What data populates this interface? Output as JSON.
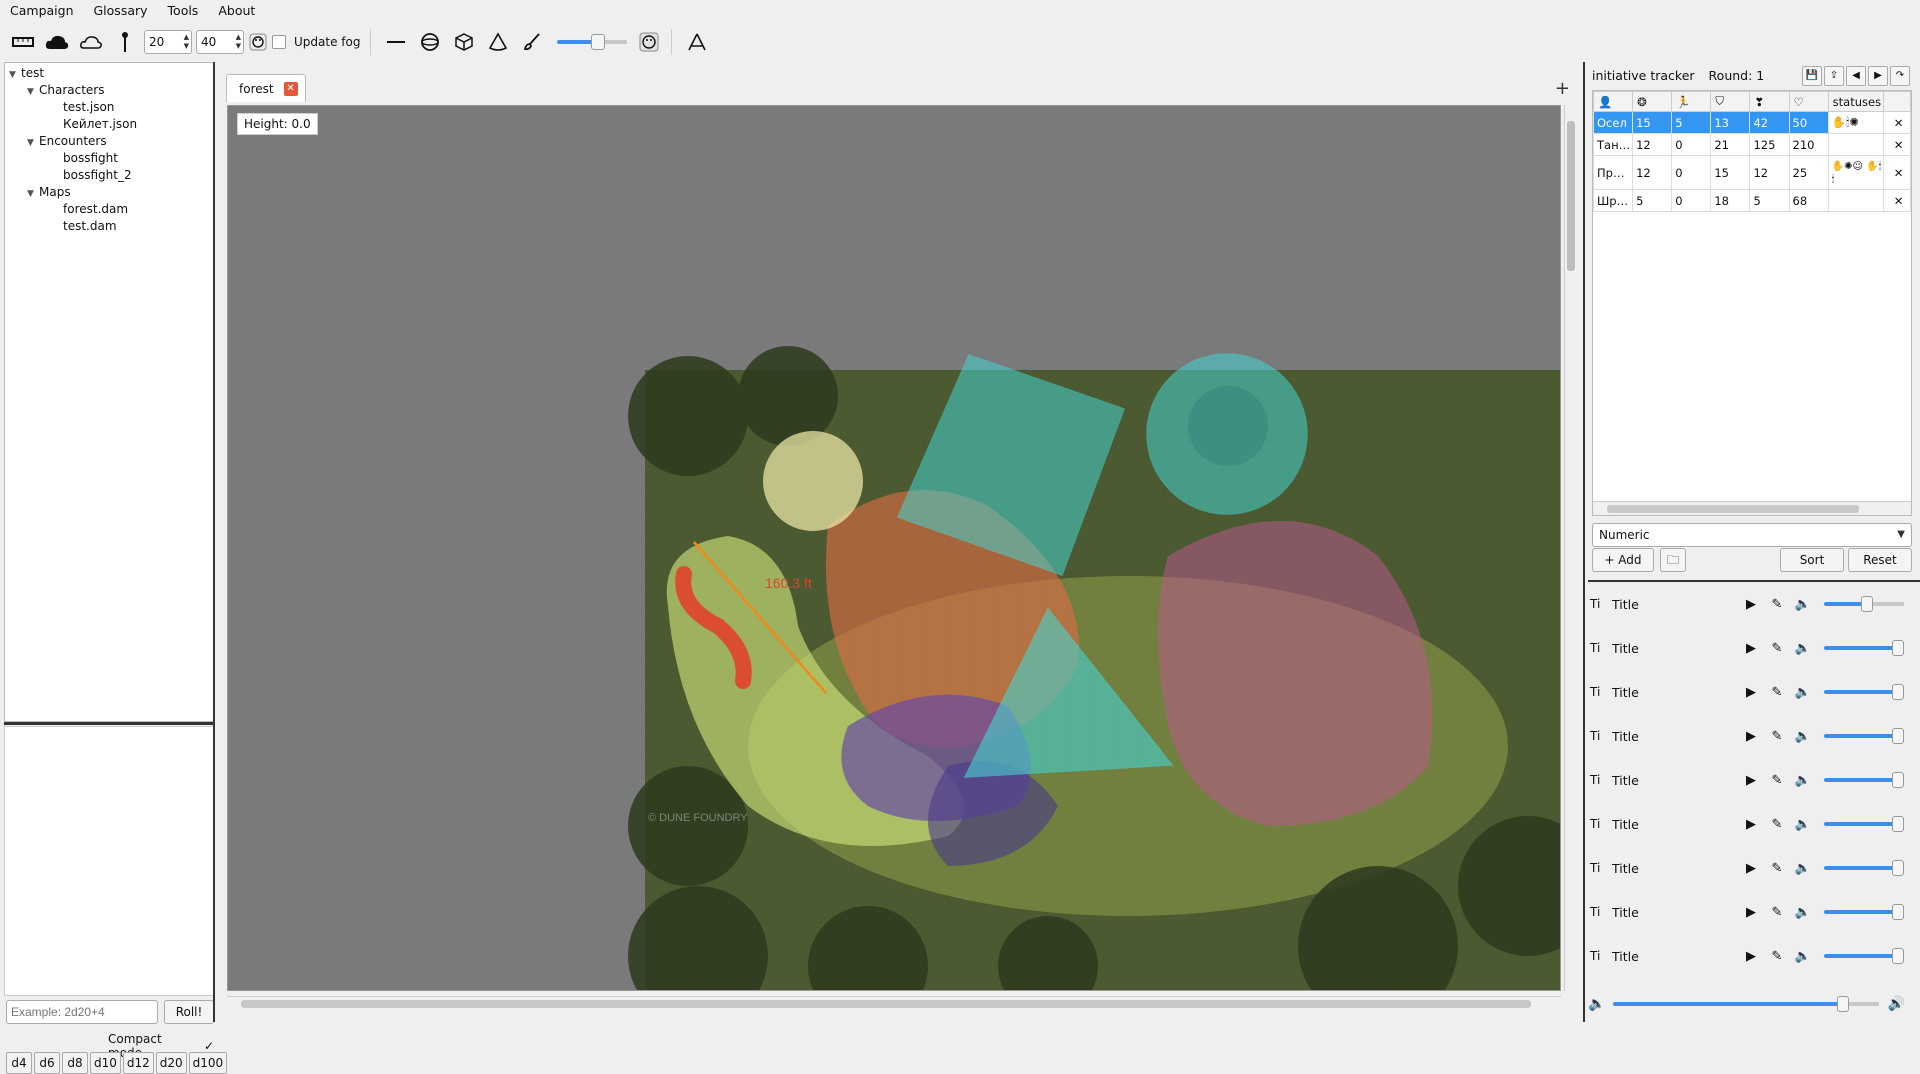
{
  "menu": [
    "Campaign",
    "Glossary",
    "Tools",
    "About"
  ],
  "toolbar": {
    "width_value": "20",
    "height_value": "40",
    "update_fog_label": "Update fog",
    "update_fog_checked": false,
    "brush_level": 0.6,
    "icons": [
      "ruler-icon",
      "cloud-filled-icon",
      "cloud-outline-icon",
      "pin-icon",
      "palette-icon",
      "line-icon",
      "sphere-icon",
      "cube-icon",
      "cone-icon",
      "brush-icon",
      "palette-icon",
      "compass-icon"
    ]
  },
  "tree": {
    "root": "test",
    "folders": [
      {
        "label": "Characters",
        "items": [
          "test.json",
          "Кейлет.json"
        ]
      },
      {
        "label": "Encounters",
        "items": [
          "bossfight",
          "bossfight_2"
        ]
      },
      {
        "label": "Maps",
        "items": [
          "forest.dam",
          "test.dam"
        ]
      }
    ]
  },
  "dice": {
    "input_value": "",
    "input_placeholder": "Example: 2d20+4",
    "roll_label": "Roll!",
    "compact_label": "Compact mode",
    "compact_checked": true,
    "buttons": [
      "d4",
      "d6",
      "d8",
      "d10",
      "d12",
      "d20",
      "d100"
    ]
  },
  "map": {
    "tab_label": "forest",
    "height_label": "Height: 0.0",
    "measure_label": "160.3 ft",
    "watermark": "© DUNE FOUNDRY"
  },
  "initiative": {
    "title": "initiative tracker",
    "round": "Round: 1",
    "header_icons": [
      "person-icon",
      "brain-icon",
      "running-icon",
      "shield-icon",
      "heart-bolt-icon",
      "heart-icon"
    ],
    "statuses_label": "statuses",
    "rows": [
      {
        "name": "Осел",
        "v1": "15",
        "v2": "5",
        "v3": "13",
        "v4": "42",
        "v5": "50",
        "statuses": "✋🕯✺",
        "selected": true
      },
      {
        "name": "Тан…",
        "v1": "12",
        "v2": "0",
        "v3": "21",
        "v4": "125",
        "v5": "210",
        "statuses": "",
        "selected": false
      },
      {
        "name": "Пр…",
        "v1": "12",
        "v2": "0",
        "v3": "15",
        "v4": "12",
        "v5": "25",
        "statuses": "✋✺☺ ✋🕯🕯",
        "selected": false
      },
      {
        "name": "Шр…",
        "v1": "5",
        "v2": "0",
        "v3": "18",
        "v4": "5",
        "v5": "68",
        "statuses": "",
        "selected": false
      }
    ],
    "mode": "Numeric",
    "add_label": "+ Add",
    "sort_label": "Sort",
    "reset_label": "Reset"
  },
  "sounds": [
    {
      "ti": "Ti",
      "title": "Title",
      "volume": 0.55
    },
    {
      "ti": "Ti",
      "title": "Title",
      "volume": 1.0
    },
    {
      "ti": "Ti",
      "title": "Title",
      "volume": 1.0
    },
    {
      "ti": "Ti",
      "title": "Title",
      "volume": 1.0
    },
    {
      "ti": "Ti",
      "title": "Title",
      "volume": 1.0
    },
    {
      "ti": "Ti",
      "title": "Title",
      "volume": 1.0
    },
    {
      "ti": "Ti",
      "title": "Title",
      "volume": 1.0
    },
    {
      "ti": "Ti",
      "title": "Title",
      "volume": 1.0
    },
    {
      "ti": "Ti",
      "title": "Title",
      "volume": 1.0
    }
  ],
  "master_volume": 0.88,
  "colors": {
    "accent": "#3396f0",
    "close": "#e4573a",
    "map_bg": "#7a7a7a"
  }
}
